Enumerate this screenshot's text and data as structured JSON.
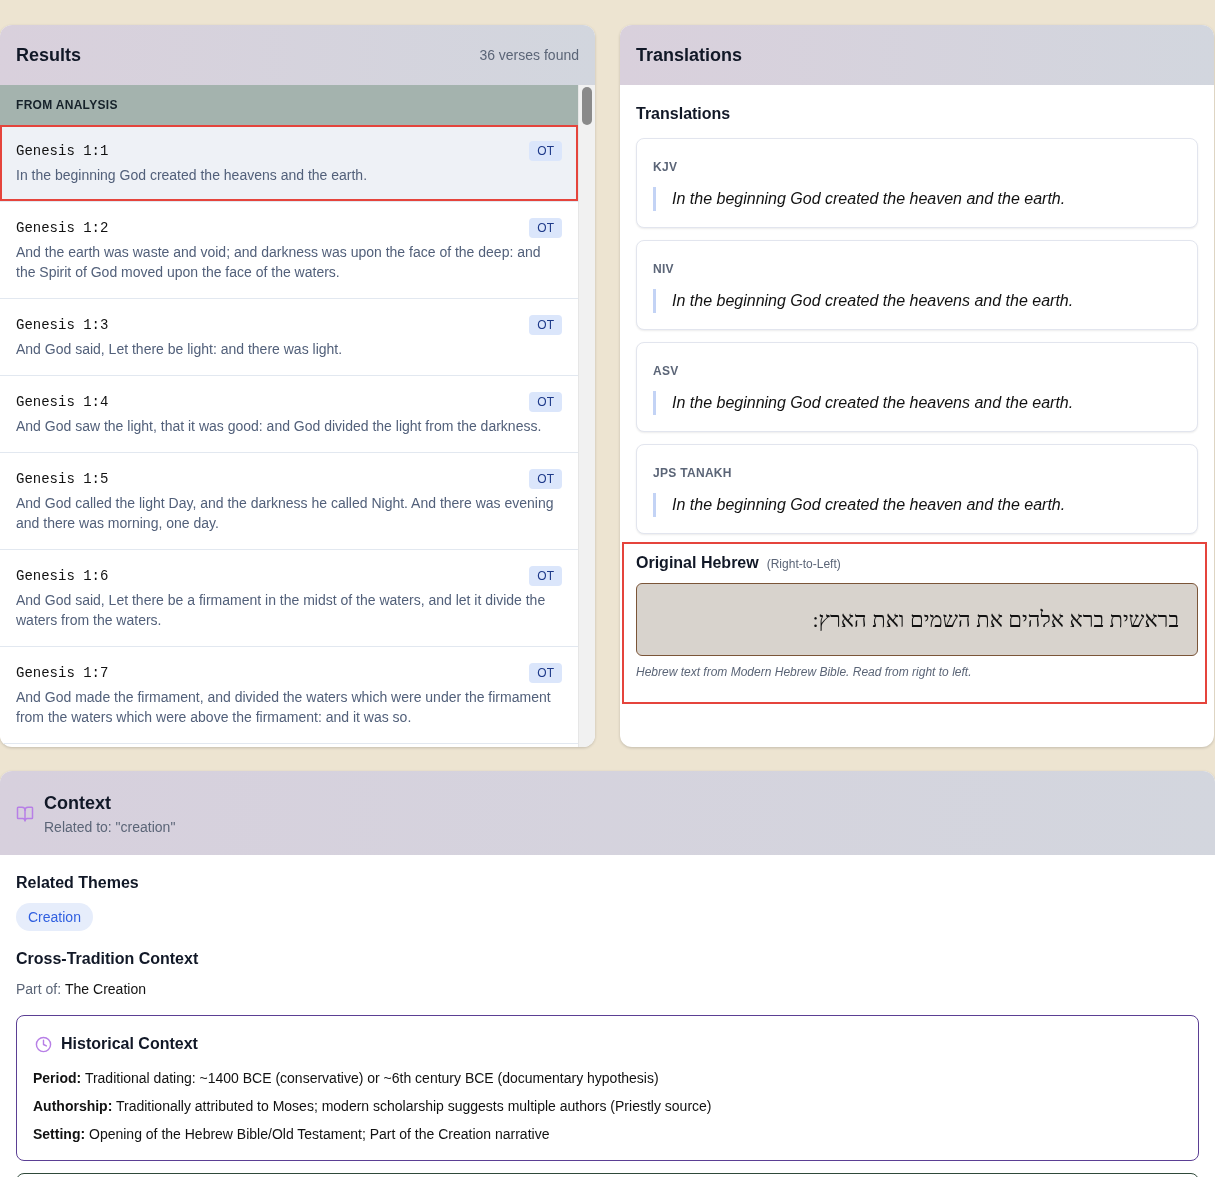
{
  "results": {
    "title": "Results",
    "count": "36 verses found",
    "group_label": "FROM ANALYSIS",
    "items": [
      {
        "reference": "Genesis 1:1",
        "badge": "OT",
        "text": "In the beginning God created the heavens and the earth.",
        "selected": true,
        "highlighted": true
      },
      {
        "reference": "Genesis 1:2",
        "badge": "OT",
        "text": "And the earth was waste and void; and darkness was upon the face of the deep: and the Spirit of God moved upon the face of the waters.",
        "selected": false,
        "highlighted": false
      },
      {
        "reference": "Genesis 1:3",
        "badge": "OT",
        "text": "And God said, Let there be light: and there was light.",
        "selected": false,
        "highlighted": false
      },
      {
        "reference": "Genesis 1:4",
        "badge": "OT",
        "text": "And God saw the light, that it was good: and God divided the light from the darkness.",
        "selected": false,
        "highlighted": false
      },
      {
        "reference": "Genesis 1:5",
        "badge": "OT",
        "text": "And God called the light Day, and the darkness he called Night. And there was evening and there was morning, one day.",
        "selected": false,
        "highlighted": false
      },
      {
        "reference": "Genesis 1:6",
        "badge": "OT",
        "text": "And God said, Let there be a firmament in the midst of the waters, and let it divide the waters from the waters.",
        "selected": false,
        "highlighted": false
      },
      {
        "reference": "Genesis 1:7",
        "badge": "OT",
        "text": "And God made the firmament, and divided the waters which were under the firmament from the waters which were above the firmament: and it was so.",
        "selected": false,
        "highlighted": false
      }
    ]
  },
  "translations": {
    "title": "Translations",
    "subtitle": "Translations",
    "versions": [
      {
        "label": "KJV",
        "text": "In the beginning God created the heaven and the earth."
      },
      {
        "label": "NIV",
        "text": "In the beginning God created the heavens and the earth."
      },
      {
        "label": "ASV",
        "text": "In the beginning God created the heavens and the earth."
      },
      {
        "label": "JPS TANAKH",
        "text": "In the beginning God created the heaven and the earth."
      }
    ],
    "original": {
      "title": "Original Hebrew",
      "direction_note": "(Right-to-Left)",
      "text": "בראשית ברא אלהים את השמים ואת הארץ:",
      "caption": "Hebrew text from Modern Hebrew Bible. Read from right to left.",
      "highlighted": true
    }
  },
  "context": {
    "title": "Context",
    "subtitle": "Related to: \"creation\"",
    "themes_title": "Related Themes",
    "themes": [
      "Creation"
    ],
    "tradition_title": "Cross-Tradition Context",
    "part_of": {
      "label": "Part of:",
      "value": "The Creation"
    },
    "cards": [
      {
        "title": "Historical Context",
        "color": "#5b3f94",
        "fields": [
          {
            "label": "Period:",
            "value": "Traditional dating: ~1400 BCE (conservative) or ~6th century BCE (documentary hypothesis)"
          },
          {
            "label": "Authorship:",
            "value": "Traditionally attributed to Moses; modern scholarship suggests multiple authors (Priestly source)"
          },
          {
            "label": "Setting:",
            "value": "Opening of the Hebrew Bible/Old Testament; Part of the Creation narrative"
          }
        ]
      },
      {
        "color": "#2f4a3a"
      }
    ]
  }
}
